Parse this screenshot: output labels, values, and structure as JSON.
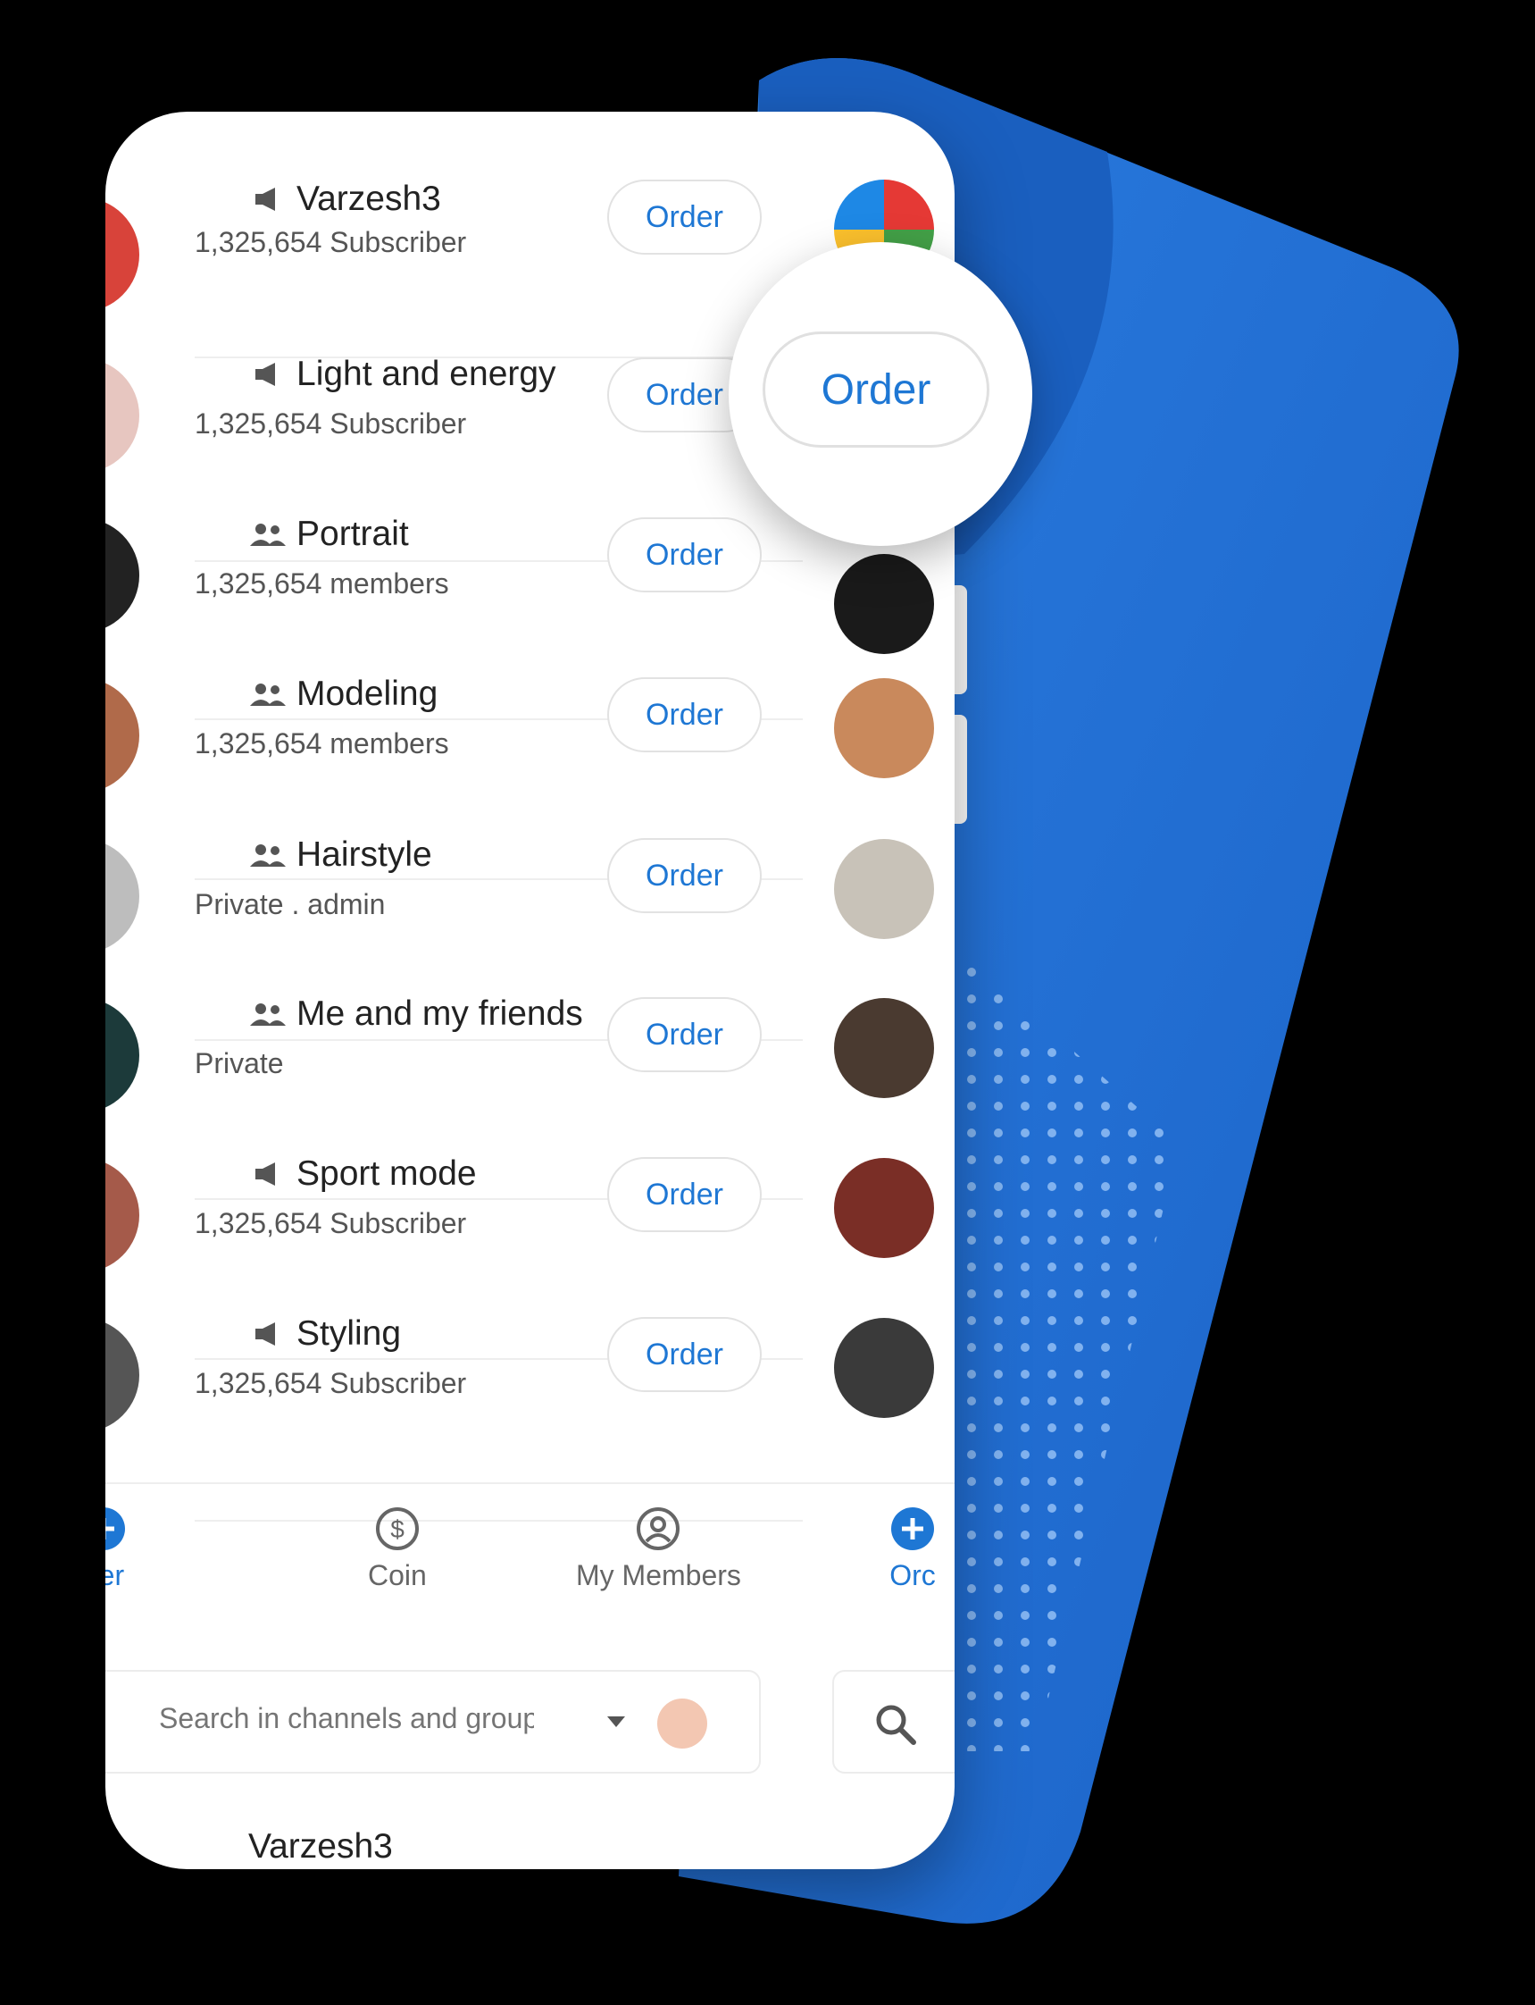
{
  "colors": {
    "accent": "#1e77d4",
    "background_shape": "#1f6fd2",
    "text_primary": "#222222",
    "text_secondary": "#555555"
  },
  "magnifier": {
    "button_label": "Order"
  },
  "rows": [
    {
      "title": "Varzesh3",
      "subtitle": "1,325,654 Subscriber",
      "kind": "megaphone-icon",
      "button": "Order"
    },
    {
      "title": "Light and energy",
      "subtitle": "1,325,654 Subscriber",
      "kind": "megaphone-icon",
      "button": "Order"
    },
    {
      "title": "Portrait",
      "subtitle": "1,325,654 members",
      "kind": "group-icon",
      "button": "Order"
    },
    {
      "title": "Modeling",
      "subtitle": "1,325,654 members",
      "kind": "group-icon",
      "button": "Order"
    },
    {
      "title": "Hairstyle",
      "subtitle": "Private . admin",
      "kind": "group-icon",
      "button": "Order"
    },
    {
      "title": "Me and my friends",
      "subtitle": "Private",
      "kind": "group-icon",
      "button": "Order"
    },
    {
      "title": "Sport mode",
      "subtitle": "1,325,654 Subscriber",
      "kind": "megaphone-icon",
      "button": "Order"
    },
    {
      "title": "Styling",
      "subtitle": "1,325,654 Subscriber",
      "kind": "megaphone-icon",
      "button": "Order"
    }
  ],
  "nav": {
    "left_partial": "der",
    "coin": "Coin",
    "my_members": "My Members",
    "right_partial": "Orc"
  },
  "search": {
    "placeholder": "Search in channels and groups"
  },
  "next_row_partial": "Varzesh3"
}
